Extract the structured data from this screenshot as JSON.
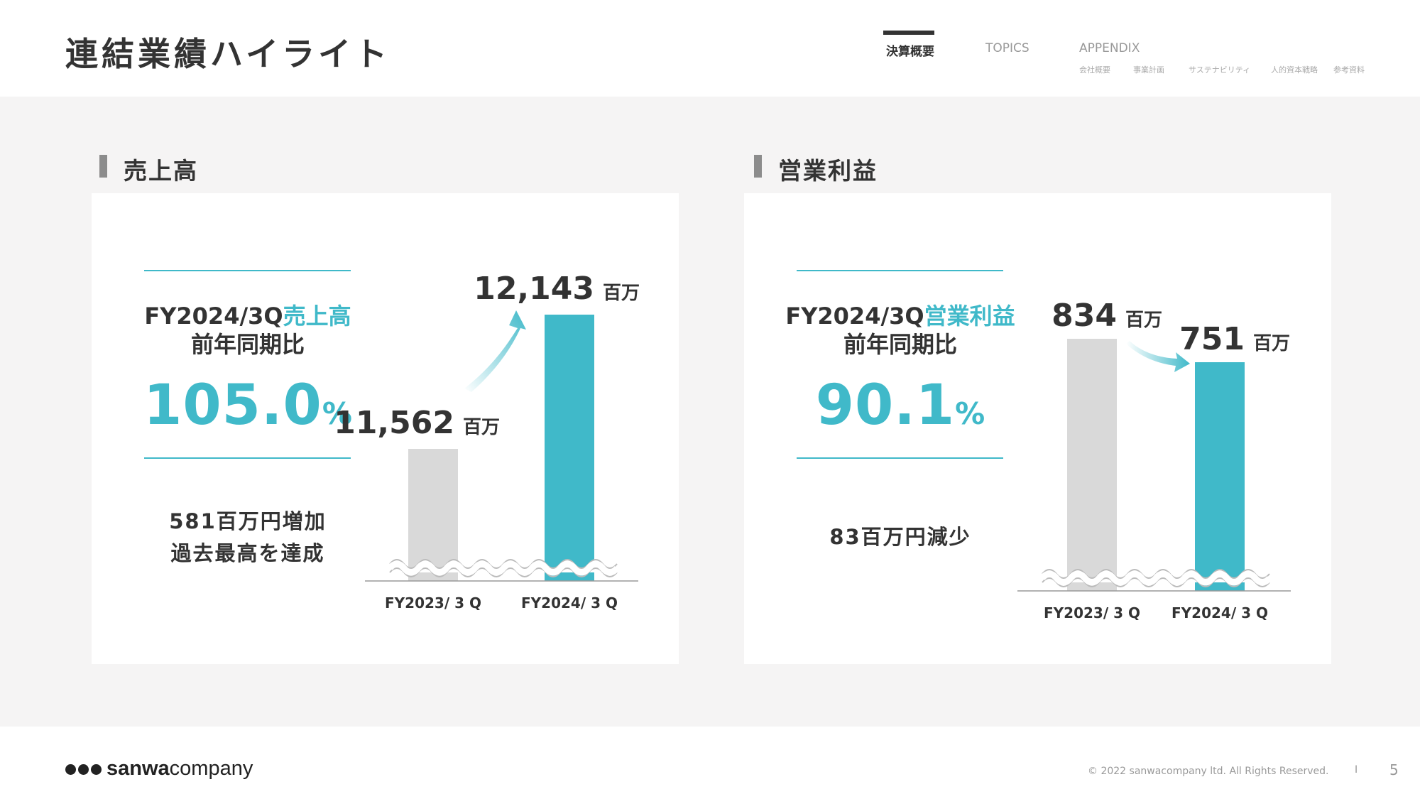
{
  "page": {
    "title": "連結業績ハイライト",
    "page_number": "5"
  },
  "nav": {
    "items": [
      {
        "label": "決算概要",
        "active": true
      },
      {
        "label": "TOPICS",
        "active": false
      },
      {
        "label": "APPENDIX",
        "active": false
      }
    ],
    "appendix_sub": [
      "会社概要",
      "事業計画",
      "サステナビリティ",
      "人的資本戦略",
      "参考資料"
    ]
  },
  "sales": {
    "section_title": "売上高",
    "kpi_prefix": "FY2024/3Q",
    "kpi_metric": "売上高",
    "kpi_sub": "前年同期比",
    "kpi_value": "105.0",
    "kpi_unit": "%",
    "note_line1": "581百万円増加",
    "note_line2": "過去最高を達成"
  },
  "profit": {
    "section_title": "営業利益",
    "kpi_prefix": "FY2024/3Q",
    "kpi_metric": "営業利益",
    "kpi_sub": "前年同期比",
    "kpi_value": "90.1",
    "kpi_unit": "%",
    "note_line1": "83百万円減少"
  },
  "chart_data": [
    {
      "type": "bar",
      "title": "売上高",
      "categories": [
        "FY2023/ 3 Q",
        "FY2024/ 3 Q"
      ],
      "values": [
        11562,
        12143
      ],
      "value_labels": [
        "11,562",
        "12,143"
      ],
      "unit": "百万",
      "axis_break": true,
      "colors": [
        "#d9d9d9",
        "#40b9c9"
      ],
      "trend": "up"
    },
    {
      "type": "bar",
      "title": "営業利益",
      "categories": [
        "FY2023/ 3 Q",
        "FY2024/ 3 Q"
      ],
      "values": [
        834,
        751
      ],
      "value_labels": [
        "834",
        "751"
      ],
      "unit": "百万",
      "axis_break": true,
      "colors": [
        "#d9d9d9",
        "#40b9c9"
      ],
      "trend": "down"
    }
  ],
  "footer": {
    "logo_bold": "sanwa",
    "logo_regular": "company",
    "copyright": "© 2022 sanwacompany ltd. All Rights Reserved.",
    "separator": "I"
  },
  "colors": {
    "accent": "#40b9c9",
    "bar_prev": "#d9d9d9",
    "text": "#333333",
    "background": "#f5f4f4"
  }
}
